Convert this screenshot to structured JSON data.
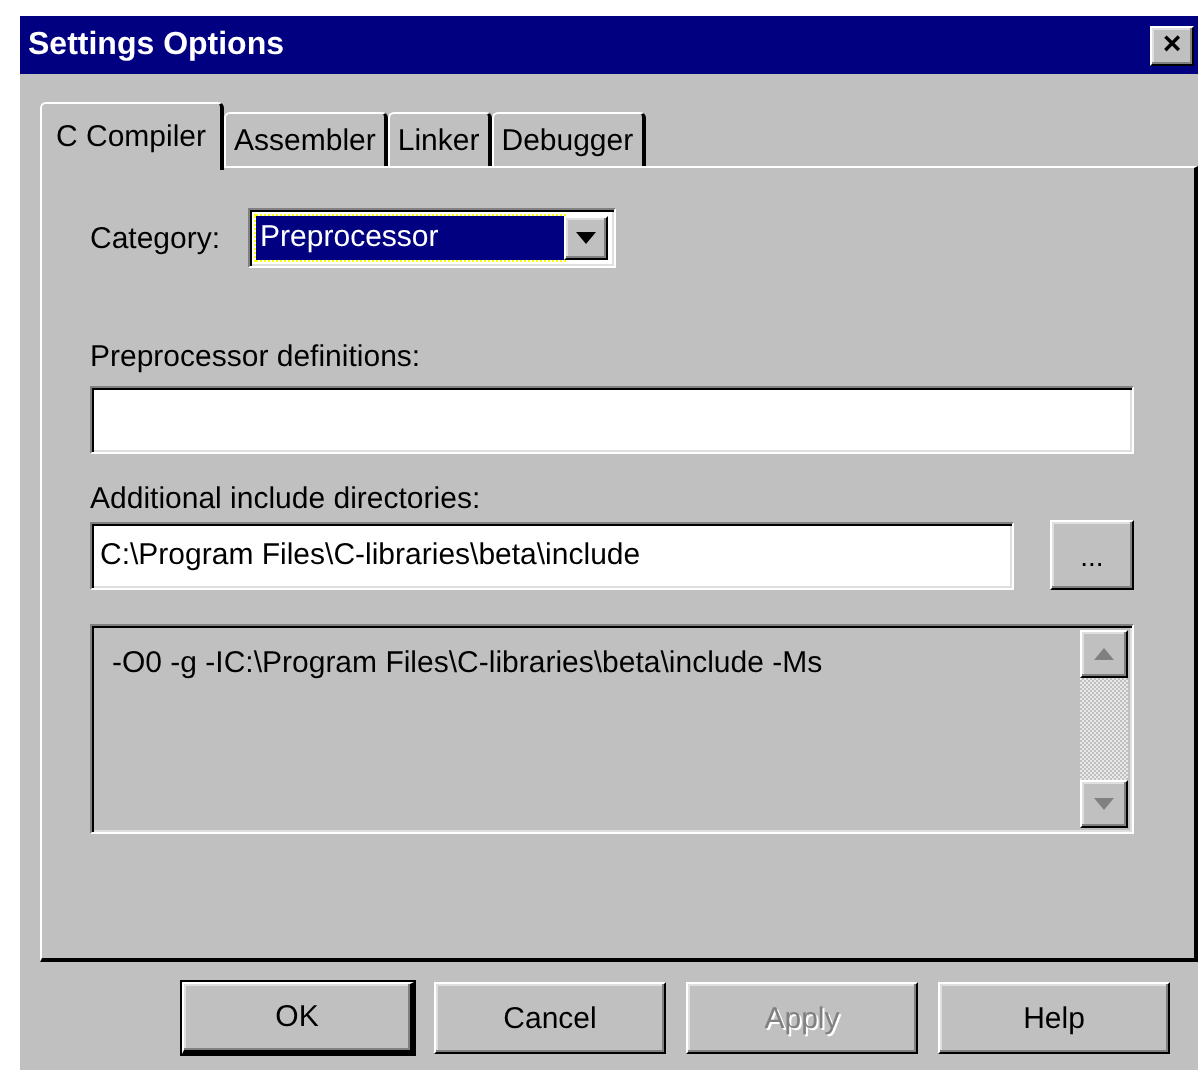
{
  "window": {
    "title": "Settings Options",
    "close": "×"
  },
  "tabs": [
    {
      "label": "C Compiler",
      "selected": true
    },
    {
      "label": "Assembler",
      "selected": false
    },
    {
      "label": "Linker",
      "selected": false
    },
    {
      "label": "Debugger",
      "selected": false
    }
  ],
  "category": {
    "label": "Category:",
    "value": "Preprocessor"
  },
  "definitions": {
    "label": "Preprocessor definitions:"
  },
  "include_dirs": {
    "label": "Additional include directories:",
    "value": "C:\\Program Files\\C-libraries\\beta\\include",
    "browse": "..."
  },
  "options_output": "-O0 -g -IC:\\Program Files\\C-libraries\\beta\\include -Ms",
  "buttons": [
    {
      "label": "OK",
      "disabled": false,
      "default": true
    },
    {
      "label": "Cancel",
      "disabled": false,
      "default": false
    },
    {
      "label": "Apply",
      "disabled": true,
      "default": false
    },
    {
      "label": "Help",
      "disabled": false,
      "default": false
    }
  ]
}
